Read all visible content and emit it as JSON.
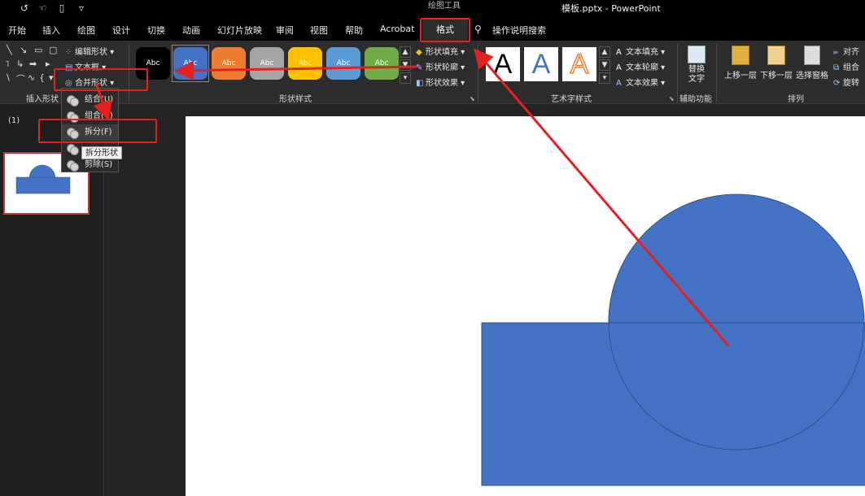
{
  "titlebar": {
    "quick_access": [
      "refresh-icon",
      "touch-mode-icon",
      "new-doc-icon",
      "customize-icon"
    ],
    "contextual_label": "绘图工具",
    "doc_title": "模板.pptx  -  PowerPoint"
  },
  "tabs": [
    "开始",
    "插入",
    "绘图",
    "设计",
    "切换",
    "动画",
    "幻灯片放映",
    "审阅",
    "视图",
    "帮助",
    "Acrobat"
  ],
  "active_tab": "格式",
  "tell_me": "操作说明搜索",
  "ribbon": {
    "insert_shapes": {
      "edit_shape": "编辑形状",
      "text_box": "文本框",
      "merge_shapes": "合并形状",
      "label": "插入形状"
    },
    "shape_styles": {
      "swatches": [
        {
          "text": "Abc",
          "color": "#000000"
        },
        {
          "text": "Abc",
          "color": "#4472c4"
        },
        {
          "text": "Abc",
          "color": "#ed7d31"
        },
        {
          "text": "Abc",
          "color": "#a5a5a5"
        },
        {
          "text": "Abc",
          "color": "#ffc000"
        },
        {
          "text": "Abc",
          "color": "#5b9bd5"
        },
        {
          "text": "Abc",
          "color": "#70ad47"
        }
      ],
      "fill": "形状填充",
      "outline": "形状轮廓",
      "effects": "形状效果",
      "label": "形状样式"
    },
    "wordart": {
      "samples": [
        "A",
        "A",
        "A"
      ],
      "text_fill": "文本填充",
      "text_outline": "文本轮廓",
      "text_effects": "文本效果",
      "label": "艺术字样式"
    },
    "accessibility": {
      "alt_text": "替换文字",
      "label": "辅助功能"
    },
    "arrange": {
      "bring_forward": "上移一层",
      "send_backward": "下移一层",
      "selection_pane": "选择窗格",
      "align": "对齐",
      "group": "组合",
      "rotate": "旋转",
      "label": "排列"
    }
  },
  "merge_menu": {
    "items": [
      "结合(U)",
      "组合(C)",
      "拆分(F)",
      "",
      "剪除(S)"
    ],
    "tooltip": "拆分形状"
  },
  "slide_pane": {
    "number": "(1)"
  },
  "colors": {
    "shape_fill": "#4472c4",
    "shape_stroke": "#2f528f",
    "annotation": "#e81f1f",
    "accent_tab": "#2e2e2e"
  }
}
